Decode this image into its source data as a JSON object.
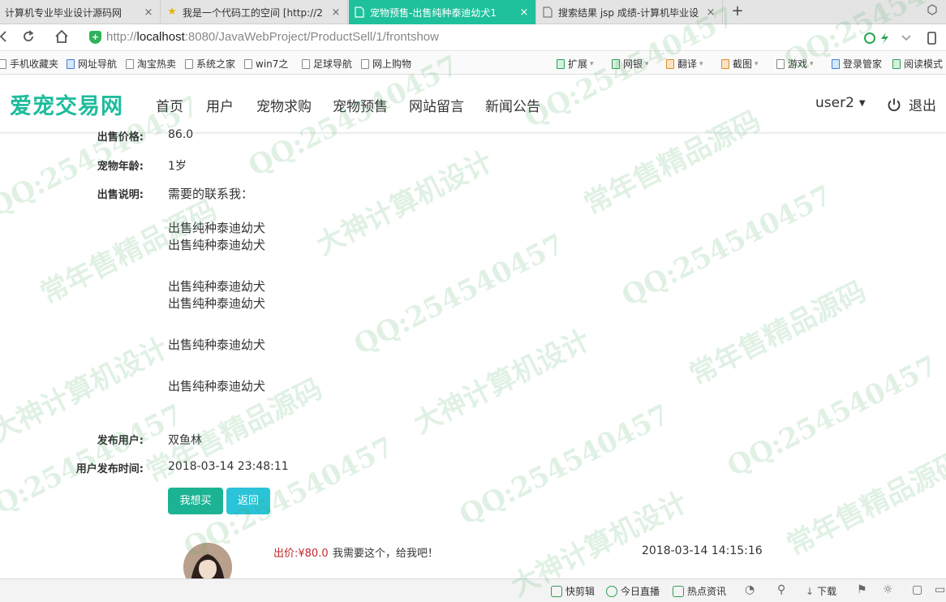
{
  "browser": {
    "tabs": [
      {
        "title": "计算机专业毕业设计源码网",
        "active": false
      },
      {
        "title": "我是一个代码工的空间 [http://2",
        "active": false
      },
      {
        "title": "宠物预售-出售纯种泰迪幼犬1",
        "active": true
      },
      {
        "title": "搜索结果 jsp 成绩-计算机毕业设",
        "active": false
      }
    ],
    "new_tab_label": "+",
    "tab_close_glyph": "×",
    "url_prefix": "http://",
    "url_host": "localhost",
    "url_rest": ":8080/JavaWebProject/ProductSell/1/frontshow",
    "bookmarks": [
      "手机收藏夹",
      "网址导航",
      "淘宝热卖",
      "系统之家",
      "win7之",
      "足球导航",
      "网上购物"
    ],
    "toolbar_right": [
      "扩展",
      "网银",
      "翻译",
      "截图",
      "游戏",
      "登录管家",
      "阅读模式"
    ],
    "status_items": [
      "快剪辑",
      "今日直播",
      "热点资讯",
      "下载"
    ]
  },
  "site": {
    "logo": "爱宠交易网",
    "nav": [
      "首页",
      "用户",
      "宠物求购",
      "宠物预售",
      "网站留言",
      "新闻公告"
    ],
    "user": "user2",
    "logout": "退出"
  },
  "detail": {
    "price_label": "出售价格:",
    "price_value": "86.0",
    "age_label": "宠物年龄:",
    "age_value": "1岁",
    "desc_label": "出售说明:",
    "desc_lines": [
      "需要的联系我：",
      "出售纯种泰迪幼犬",
      "出售纯种泰迪幼犬",
      "出售纯种泰迪幼犬",
      "出售纯种泰迪幼犬",
      "出售纯种泰迪幼犬",
      "出售纯种泰迪幼犬"
    ],
    "publisher_label": "发布用户:",
    "publisher_value": "双鱼林",
    "time_label": "用户发布时间:",
    "time_value": "2018-03-14 23:48:11",
    "buy_button": "我想买",
    "back_button": "返回"
  },
  "comment": {
    "price_text": "出价:¥80.0",
    "message": "我需要这个，给我吧！",
    "time": "2018-03-14 14:15:16"
  },
  "watermark": {
    "qq": "QQ:254540457",
    "line_a": "常年售精品源码",
    "line_b": "大神计算机设计"
  },
  "colors": {
    "accent": "#1fbc9c",
    "active_tab": "#1ec19c",
    "buy_button": "#1cb394",
    "back_button": "#2bc3d7",
    "bid_price": "#c3282e"
  }
}
